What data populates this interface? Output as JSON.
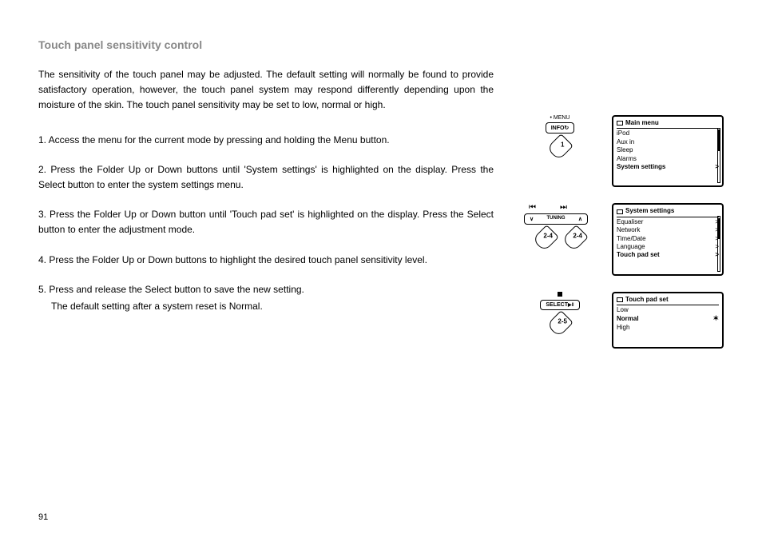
{
  "heading": "Touch panel sensitivity control",
  "intro": "The sensitivity of the touch panel may be adjusted. The default setting will normally be found to provide satisfactory operation, however, the touch panel system may respond differently depending upon the moisture of the skin. The touch panel sensitivity may be set to low, normal or high.",
  "steps": {
    "s1": "1. Access the menu for the current mode by pressing and holding the Menu button.",
    "s2": "2. Press the Folder Up or Down buttons until 'System settings' is highlighted on the display. Press the Select button to enter the system settings menu.",
    "s3": "3. Press the Folder Up or Down button until 'Touch pad set' is highlighted on the display. Press the Select button to enter the adjustment mode.",
    "s4": "4. Press the Folder Up or Down buttons to highlight the desired touch panel sensitivity level.",
    "s5": "5. Press and release the Select button to save the new setting.",
    "s5b": "The default setting after a system reset is Normal."
  },
  "buttons": {
    "menu_top": "• MENU",
    "info": "INFO",
    "tuning": "TUNING",
    "select": "SELECT",
    "step1": "1",
    "step24": "2-4",
    "step25": "2-5"
  },
  "screens": {
    "main": {
      "title": "Main menu",
      "items": [
        "iPod",
        "Aux in",
        "Sleep",
        "Alarms"
      ],
      "highlight": "System settings"
    },
    "system": {
      "title": "System settings",
      "items": [
        "Equaliser",
        "Network",
        "Time/Date",
        "Language"
      ],
      "highlight": "Touch pad set"
    },
    "touch": {
      "title": "Touch pad set",
      "low": "Low",
      "normal": "Normal",
      "high": "High"
    }
  },
  "page_number": "91"
}
